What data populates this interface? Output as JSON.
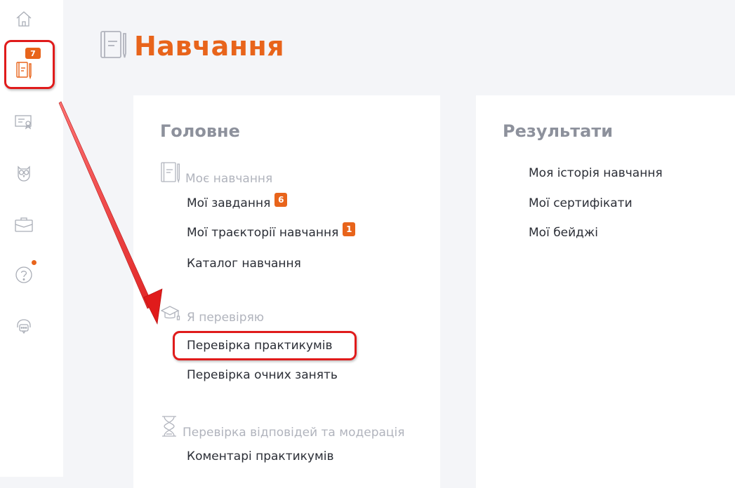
{
  "sidebar": {
    "items": [
      {
        "icon": "home-icon"
      },
      {
        "icon": "learning-book-icon",
        "badge": "7",
        "active": true
      },
      {
        "icon": "certificate-icon"
      },
      {
        "icon": "owl-icon"
      },
      {
        "icon": "briefcase-icon"
      },
      {
        "icon": "help-icon",
        "has_dot": true
      },
      {
        "icon": "support-chat-icon"
      }
    ]
  },
  "page": {
    "title": "Навчання"
  },
  "main_card": {
    "title": "Головне",
    "sections": [
      {
        "heading": "Моє навчання",
        "icon": "book-icon",
        "links": [
          {
            "label": "Мої завдання",
            "badge": "6"
          },
          {
            "label": "Мої траєкторії навчання",
            "badge": "1"
          },
          {
            "label": "Каталог навчання"
          }
        ]
      },
      {
        "heading": "Я перевіряю",
        "icon": "graduation-cap-icon",
        "links": [
          {
            "label": "Перевірка практикумів",
            "highlighted": true
          },
          {
            "label": "Перевірка очних занять"
          }
        ]
      },
      {
        "heading": "Перевірка відповідей та модерація",
        "icon": "hourglass-icon",
        "links": [
          {
            "label": "Коментарі практикумів"
          }
        ]
      }
    ]
  },
  "results_card": {
    "title": "Результати",
    "links": [
      {
        "label": "Моя історія навчання"
      },
      {
        "label": "Мої сертифікати"
      },
      {
        "label": "Мої бейджі"
      }
    ]
  },
  "colors": {
    "accent": "#e8641b",
    "highlight": "#e01b1b",
    "muted_text": "#b1b4bd",
    "card_title": "#8d919c",
    "link_text": "#2b2e36",
    "background": "#f4f5f8"
  }
}
